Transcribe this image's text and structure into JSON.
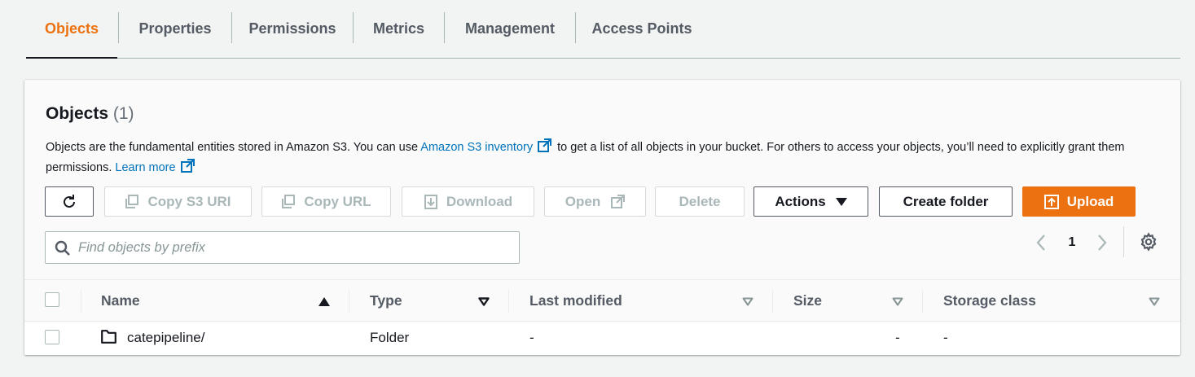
{
  "tabs": [
    {
      "label": "Objects",
      "active": true
    },
    {
      "label": "Properties"
    },
    {
      "label": "Permissions"
    },
    {
      "label": "Metrics"
    },
    {
      "label": "Management"
    },
    {
      "label": "Access Points"
    }
  ],
  "panel": {
    "title": "Objects",
    "count": "(1)",
    "desc_1": "Objects are the fundamental entities stored in Amazon S3. You can use ",
    "desc_link": "Amazon S3 inventory",
    "desc_2": " to get a list of all objects in your bucket. For others to access your objects, you’ll need to explicitly grant them permissions.",
    "learn_more": "Learn more"
  },
  "toolbar": {
    "copy_s3_uri": "Copy S3 URI",
    "copy_url": "Copy URL",
    "download": "Download",
    "open": "Open",
    "delete": "Delete",
    "actions": "Actions",
    "create_folder": "Create folder",
    "upload": "Upload"
  },
  "search": {
    "placeholder": "Find objects by prefix",
    "value": ""
  },
  "pagination": {
    "current_page": "1"
  },
  "table": {
    "columns": [
      "Name",
      "Type",
      "Last modified",
      "Size",
      "Storage class"
    ],
    "rows": [
      {
        "name": "catepipeline/",
        "type": "Folder",
        "last_modified": "-",
        "size": "-",
        "storage_class": "-"
      }
    ]
  },
  "colors": {
    "accent": "#ec7211",
    "link": "#0073bb",
    "text": "#16191f",
    "muted": "#545b64"
  },
  "icons": [
    "refresh-icon",
    "copy-icon",
    "download-icon",
    "external-link-icon",
    "caret-down-icon",
    "upload-icon",
    "search-icon",
    "chevron-left-icon",
    "chevron-right-icon",
    "gear-icon",
    "sort-ascending-icon",
    "sort-descending-icon",
    "folder-icon"
  ]
}
